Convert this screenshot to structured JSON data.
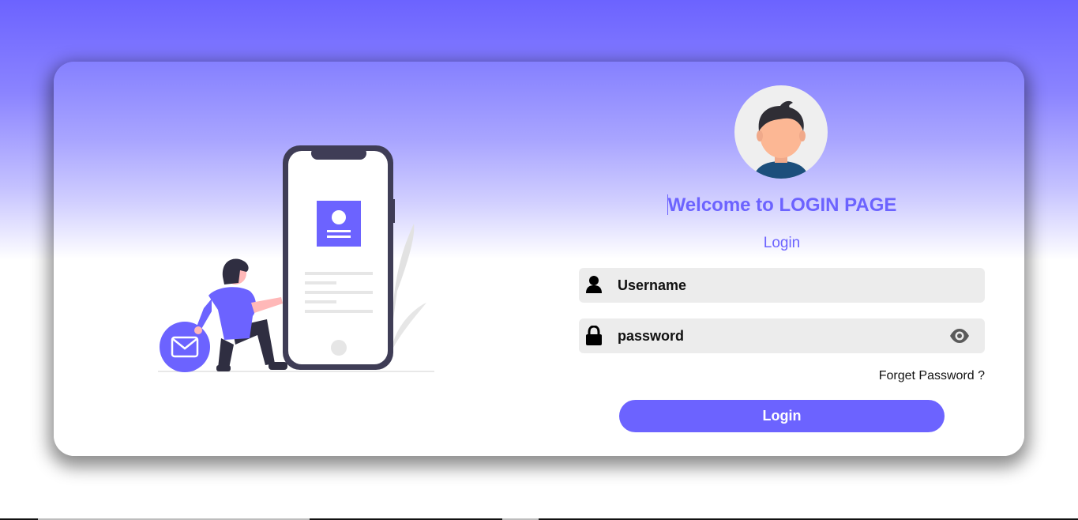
{
  "login": {
    "welcome_title": "Welcome to LOGIN PAGE",
    "subtitle": "Login",
    "username_value": "Username",
    "password_value": "password",
    "forgot_label": "Forget Password ?",
    "login_button_label": "Login"
  },
  "icons": {
    "username": "user-icon",
    "password": "lock-icon",
    "toggle_visibility": "eye-icon",
    "avatar": "user-avatar",
    "illustration": "phone-login-illustration"
  },
  "colors": {
    "accent": "#6c63ff",
    "field_bg": "#ececec",
    "text": "#111111"
  }
}
